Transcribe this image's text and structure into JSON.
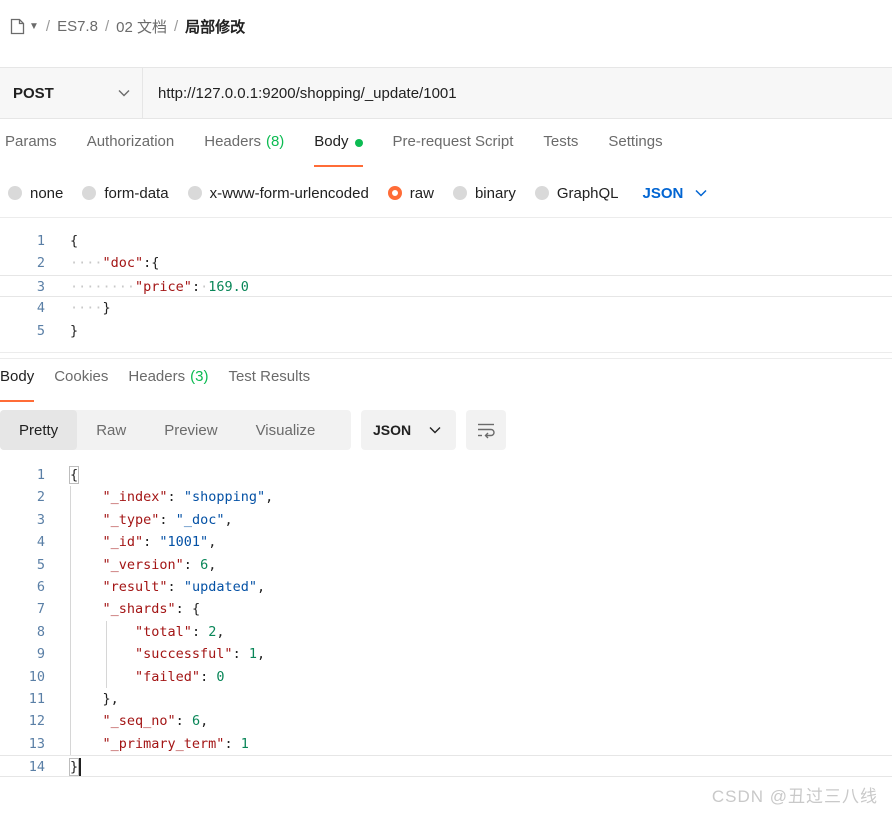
{
  "breadcrumb": {
    "items": [
      "ES7.8",
      "02 文档",
      "局部修改"
    ]
  },
  "request": {
    "method": "POST",
    "url": "http://127.0.0.1:9200/shopping/_update/1001"
  },
  "request_tabs": [
    {
      "label": "Params"
    },
    {
      "label": "Authorization"
    },
    {
      "label": "Headers",
      "count": "(8)"
    },
    {
      "label": "Body"
    },
    {
      "label": "Pre-request Script"
    },
    {
      "label": "Tests"
    },
    {
      "label": "Settings"
    }
  ],
  "body_types": {
    "options": [
      "none",
      "form-data",
      "x-www-form-urlencoded",
      "raw",
      "binary",
      "GraphQL"
    ],
    "selected": "raw",
    "format": "JSON"
  },
  "request_body": {
    "line_numbers": [
      "1",
      "2",
      "3",
      "4",
      "5"
    ],
    "l1": "{",
    "l2_key": "\"doc\"",
    "l2_punc": ":",
    "l2_brace": "{",
    "l3_key": "\"price\"",
    "l3_punc": ":",
    "l3_val": "169.0",
    "l4": "}",
    "l5": "}"
  },
  "response_tabs": [
    {
      "label": "Body"
    },
    {
      "label": "Cookies"
    },
    {
      "label": "Headers",
      "count": "(3)"
    },
    {
      "label": "Test Results"
    }
  ],
  "response_view": {
    "modes": [
      "Pretty",
      "Raw",
      "Preview",
      "Visualize"
    ],
    "active": "Pretty",
    "format": "JSON"
  },
  "response_body": {
    "line_numbers": [
      "1",
      "2",
      "3",
      "4",
      "5",
      "6",
      "7",
      "8",
      "9",
      "10",
      "11",
      "12",
      "13",
      "14"
    ],
    "open": "{",
    "index_key": "\"_index\"",
    "index_val": "\"shopping\"",
    "type_key": "\"_type\"",
    "type_val": "\"_doc\"",
    "id_key": "\"_id\"",
    "id_val": "\"1001\"",
    "version_key": "\"_version\"",
    "version_val": "6",
    "result_key": "\"result\"",
    "result_val": "\"updated\"",
    "shards_key": "\"_shards\"",
    "shards_open": "{",
    "total_key": "\"total\"",
    "total_val": "2",
    "successful_key": "\"successful\"",
    "successful_val": "1",
    "failed_key": "\"failed\"",
    "failed_val": "0",
    "shards_close": "}",
    "seq_key": "\"_seq_no\"",
    "seq_val": "6",
    "term_key": "\"_primary_term\"",
    "term_val": "1",
    "close": "}"
  },
  "watermark": "CSDN @丑过三八线",
  "icons": {
    "document": "document-icon",
    "dropdown": "chevron-down-icon",
    "wrap": "wrap-lines-icon"
  },
  "colors": {
    "accent_orange": "#ff6c37",
    "success_green": "#0cbb52",
    "link_blue": "#0265d2"
  }
}
